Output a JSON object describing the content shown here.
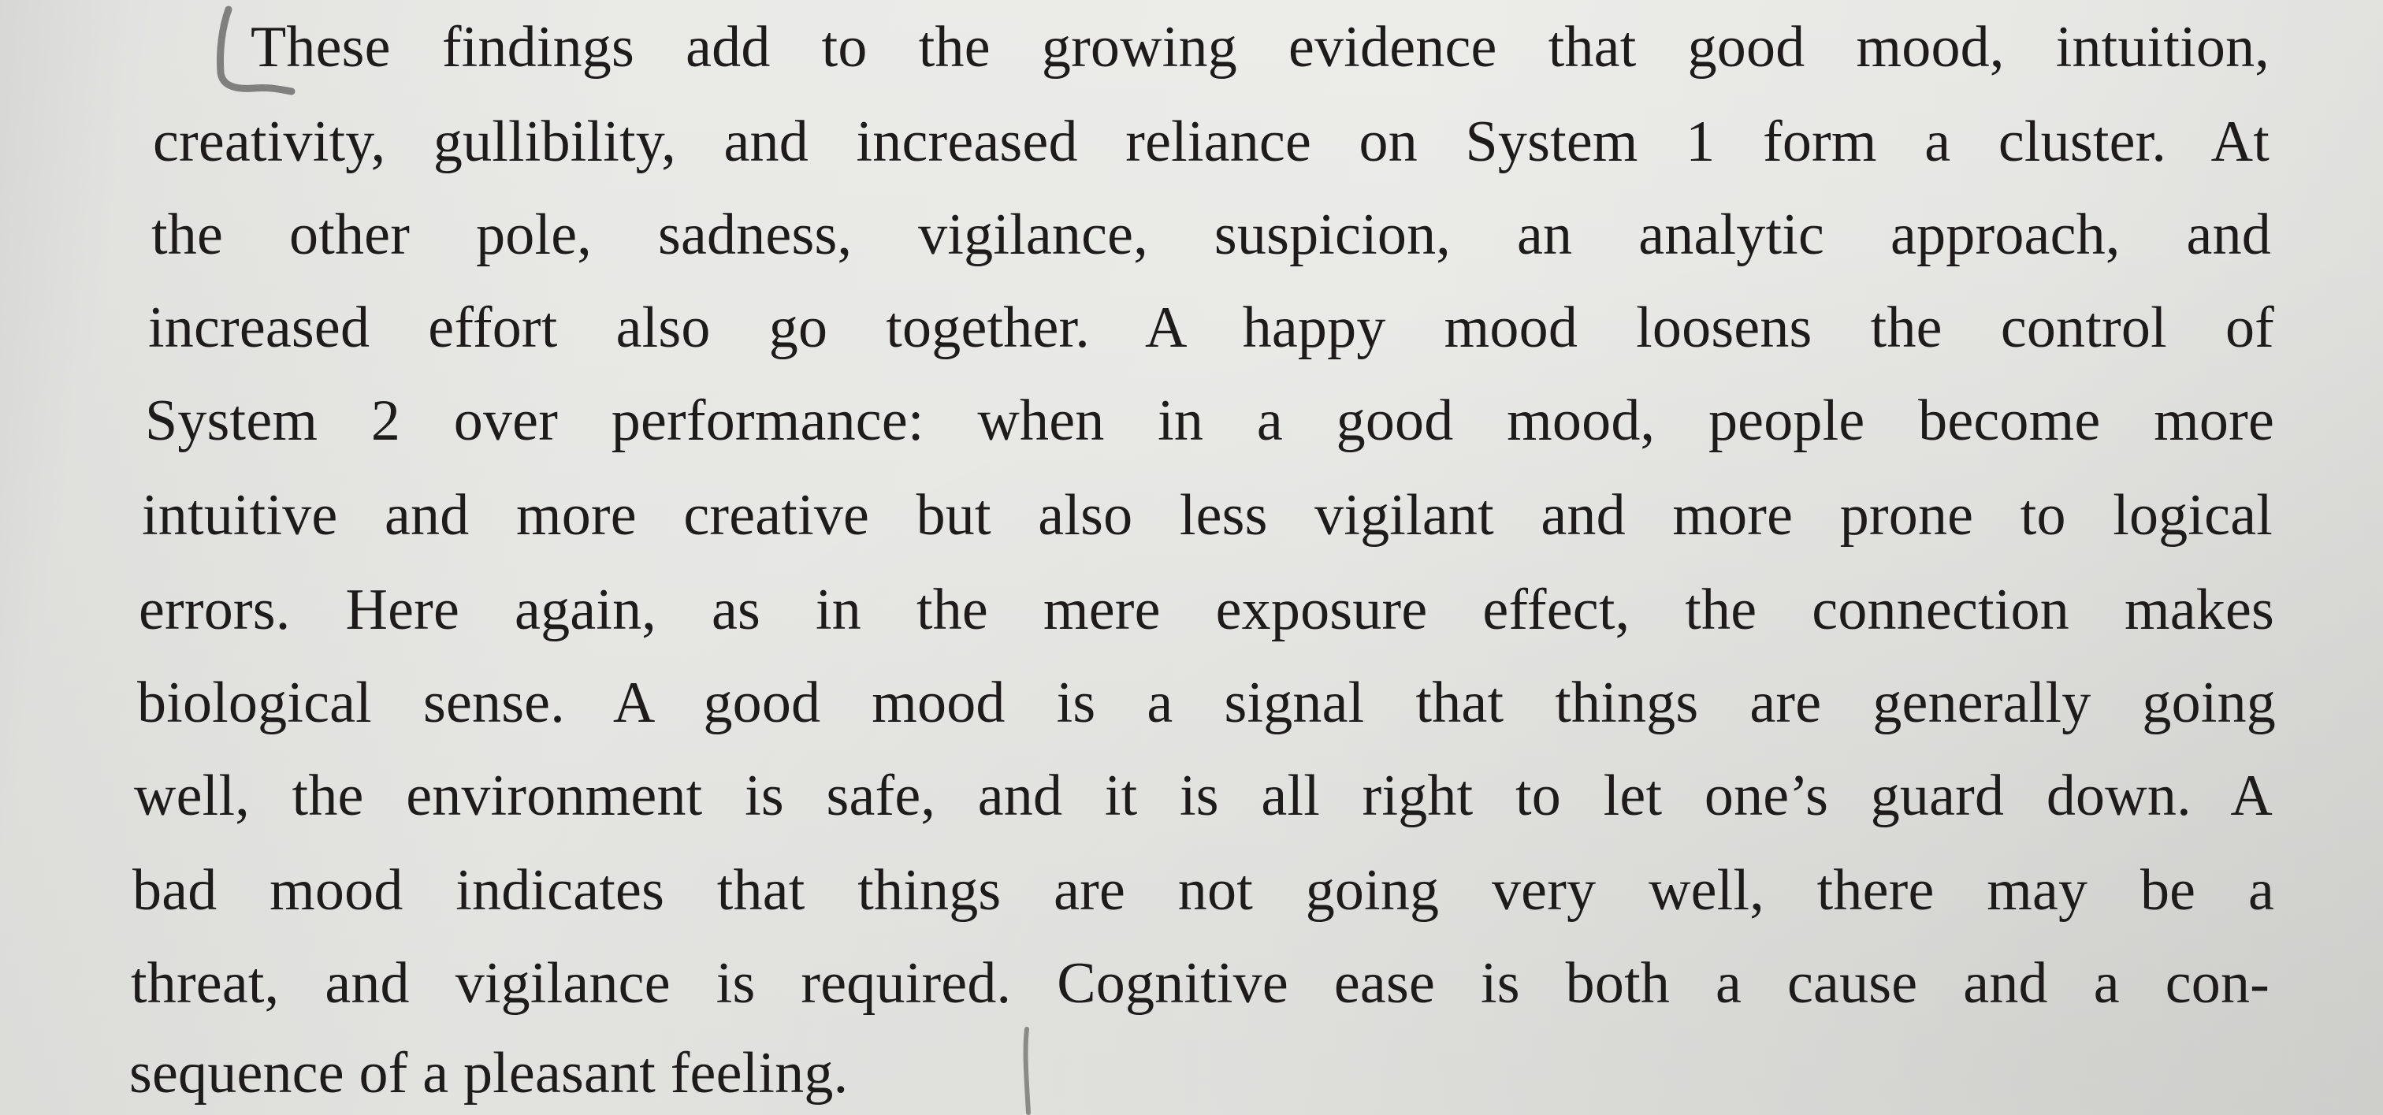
{
  "passage": {
    "lines": [
      "These findings add to the growing evidence that good mood, intuition,",
      "creativity, gullibility, and increased reliance on System 1 form a cluster. At",
      "the other pole, sadness, vigilance, suspicion, an analytic approach, and",
      "increased effort also go together. A happy mood loosens the control of",
      "System 2 over performance: when in a good mood, people become more",
      "intuitive and more creative but also less vigilant and more prone to logical",
      "errors. Here again, as in the mere exposure effect, the connection makes",
      "biological sense. A good mood is a signal that things are generally going",
      "well, the environment is safe, and it is all right to let one’s guard down. A",
      "bad mood indicates that things are not going very well, there may be a",
      "threat, and vigilance is required. Cognitive ease is both a cause and a con-",
      "sequence of a pleasant feeling."
    ]
  },
  "annotations": {
    "open_bracket": "pencil-open-bracket",
    "close_mark": "pencil-close-mark"
  }
}
